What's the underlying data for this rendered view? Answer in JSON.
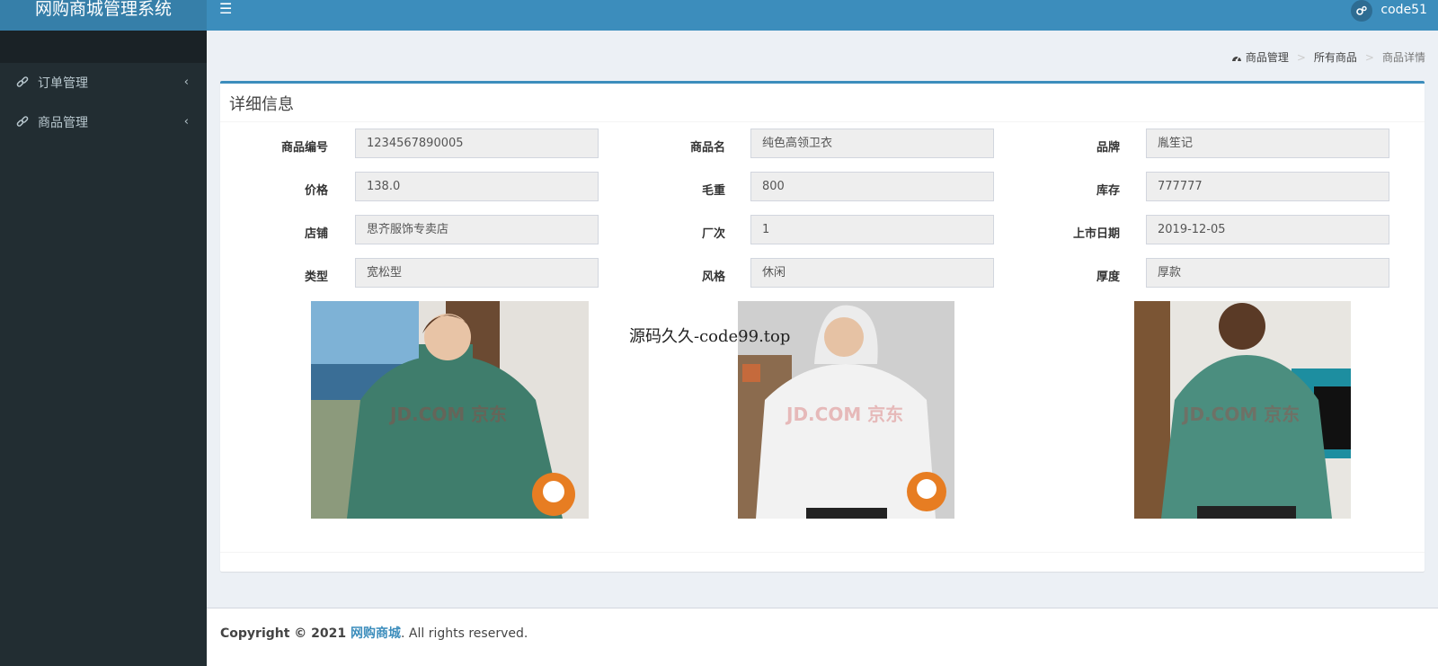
{
  "app": {
    "title": "网购商城管理系统"
  },
  "header": {
    "user_name": "code51"
  },
  "sidebar": {
    "items": [
      {
        "label": "订单管理"
      },
      {
        "label": "商品管理"
      }
    ]
  },
  "breadcrumb": {
    "items": [
      "商品管理",
      "所有商品",
      "商品详情"
    ],
    "separator": ">"
  },
  "panel": {
    "title": "详细信息"
  },
  "fields": {
    "product_id": {
      "label": "商品编号",
      "value": "1234567890005"
    },
    "product_name": {
      "label": "商品名",
      "value": "纯色高领卫衣"
    },
    "brand": {
      "label": "品牌",
      "value": "胤笙记"
    },
    "price": {
      "label": "价格",
      "value": "138.0"
    },
    "weight": {
      "label": "毛重",
      "value": "800"
    },
    "stock": {
      "label": "库存",
      "value": "777777"
    },
    "shop": {
      "label": "店铺",
      "value": "思齐服饰专卖店"
    },
    "factory": {
      "label": "厂次",
      "value": "1"
    },
    "release_date": {
      "label": "上市日期",
      "value": "2019-12-05"
    },
    "type": {
      "label": "类型",
      "value": "宽松型"
    },
    "style": {
      "label": "风格",
      "value": "休闲"
    },
    "thickness": {
      "label": "厚度",
      "value": "厚款"
    }
  },
  "images": {
    "watermark": "JD.COM 京东",
    "items": [
      {
        "name": "green-hoodie-front",
        "colors": {
          "sweater": "#3f7d6c",
          "bg": "#7eb2d6"
        }
      },
      {
        "name": "white-hoodie-front",
        "colors": {
          "sweater": "#f2f2f2",
          "bg": "#c9c9c9"
        }
      },
      {
        "name": "green-hoodie-back",
        "colors": {
          "sweater": "#4b8e7f",
          "bg": "#e8e6e1"
        }
      }
    ]
  },
  "overlay": {
    "text": "源码久久-code99.top"
  },
  "footer": {
    "prefix": "Copyright © 2021",
    "link": "网购商城",
    "suffix": ". All rights reserved."
  },
  "colors": {
    "primary": "#3c8dbc",
    "sidebar": "#222d32",
    "logo_bg": "#367fa9"
  }
}
